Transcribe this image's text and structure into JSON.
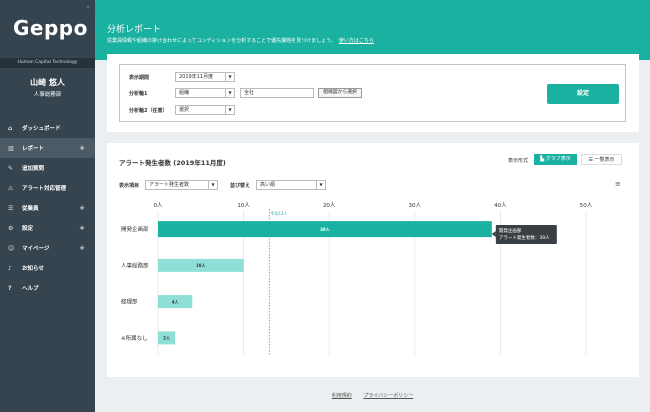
{
  "sidebar": {
    "logo": "Geppo",
    "collapse_icon": "«",
    "tagline": "Human Capital Technology",
    "user_name": "山崎 悠人",
    "user_dept": "人事総務部",
    "items": [
      {
        "label": "ダッシュボード",
        "icon": "⌂",
        "plus": ""
      },
      {
        "label": "レポート",
        "icon": "▥",
        "plus": "+"
      },
      {
        "label": "追加質問",
        "icon": "✎",
        "plus": ""
      },
      {
        "label": "アラート対応管理",
        "icon": "⚠",
        "plus": ""
      },
      {
        "label": "従業員",
        "icon": "☰",
        "plus": "+"
      },
      {
        "label": "設定",
        "icon": "⚙",
        "plus": "+"
      },
      {
        "label": "マイページ",
        "icon": "☺",
        "plus": "+"
      },
      {
        "label": "お知らせ",
        "icon": "♪",
        "plus": ""
      },
      {
        "label": "ヘルプ",
        "icon": "?",
        "plus": ""
      }
    ]
  },
  "header": {
    "title": "分析レポート",
    "description": "従業員情報や組織の掛け合わせによってコンディションを分析することで優先課題を見つけましょう。",
    "link": "使い方はこちら"
  },
  "filters": {
    "period_label": "表示期間",
    "period_value": "2019年11月度",
    "axis1_label": "分析軸1",
    "axis1_value": "組織",
    "axis1_text": "全社",
    "org_button": "組織図から選択",
    "axis2_label": "分析軸2（任意）",
    "axis2_value": "選択",
    "set_button": "設定"
  },
  "chart_panel": {
    "title": "アラート発生者数 (2019年11月度)",
    "view_label": "表示形式",
    "graph_button": "グラフ表示",
    "list_button": "一覧表示",
    "item_label": "表示項目",
    "item_value": "アラート発生者数",
    "sort_label": "並び替え",
    "sort_value": "高い順"
  },
  "chart_data": {
    "type": "bar",
    "orientation": "horizontal",
    "categories": [
      "開発企画部",
      "人事総務部",
      "経理部",
      "※所属なし"
    ],
    "values": [
      39,
      10,
      4,
      2
    ],
    "value_labels": [
      "39人",
      "10人",
      "4人",
      "2人"
    ],
    "x_ticks": [
      "0人",
      "10人",
      "20人",
      "30人",
      "40人",
      "50人"
    ],
    "xlim": [
      0,
      50
    ],
    "grid": true,
    "average_line": {
      "value": 13,
      "label": "平均13人"
    },
    "tooltip": {
      "title": "開発企画部",
      "text": "アラート発生者数：39人"
    },
    "colors": {
      "highlight": "#1bb1a0",
      "normal": "#8ee0d6",
      "average": "#1bb1a0"
    }
  },
  "footer": {
    "terms": "利用規約",
    "privacy": "プライバシーポリシー"
  }
}
